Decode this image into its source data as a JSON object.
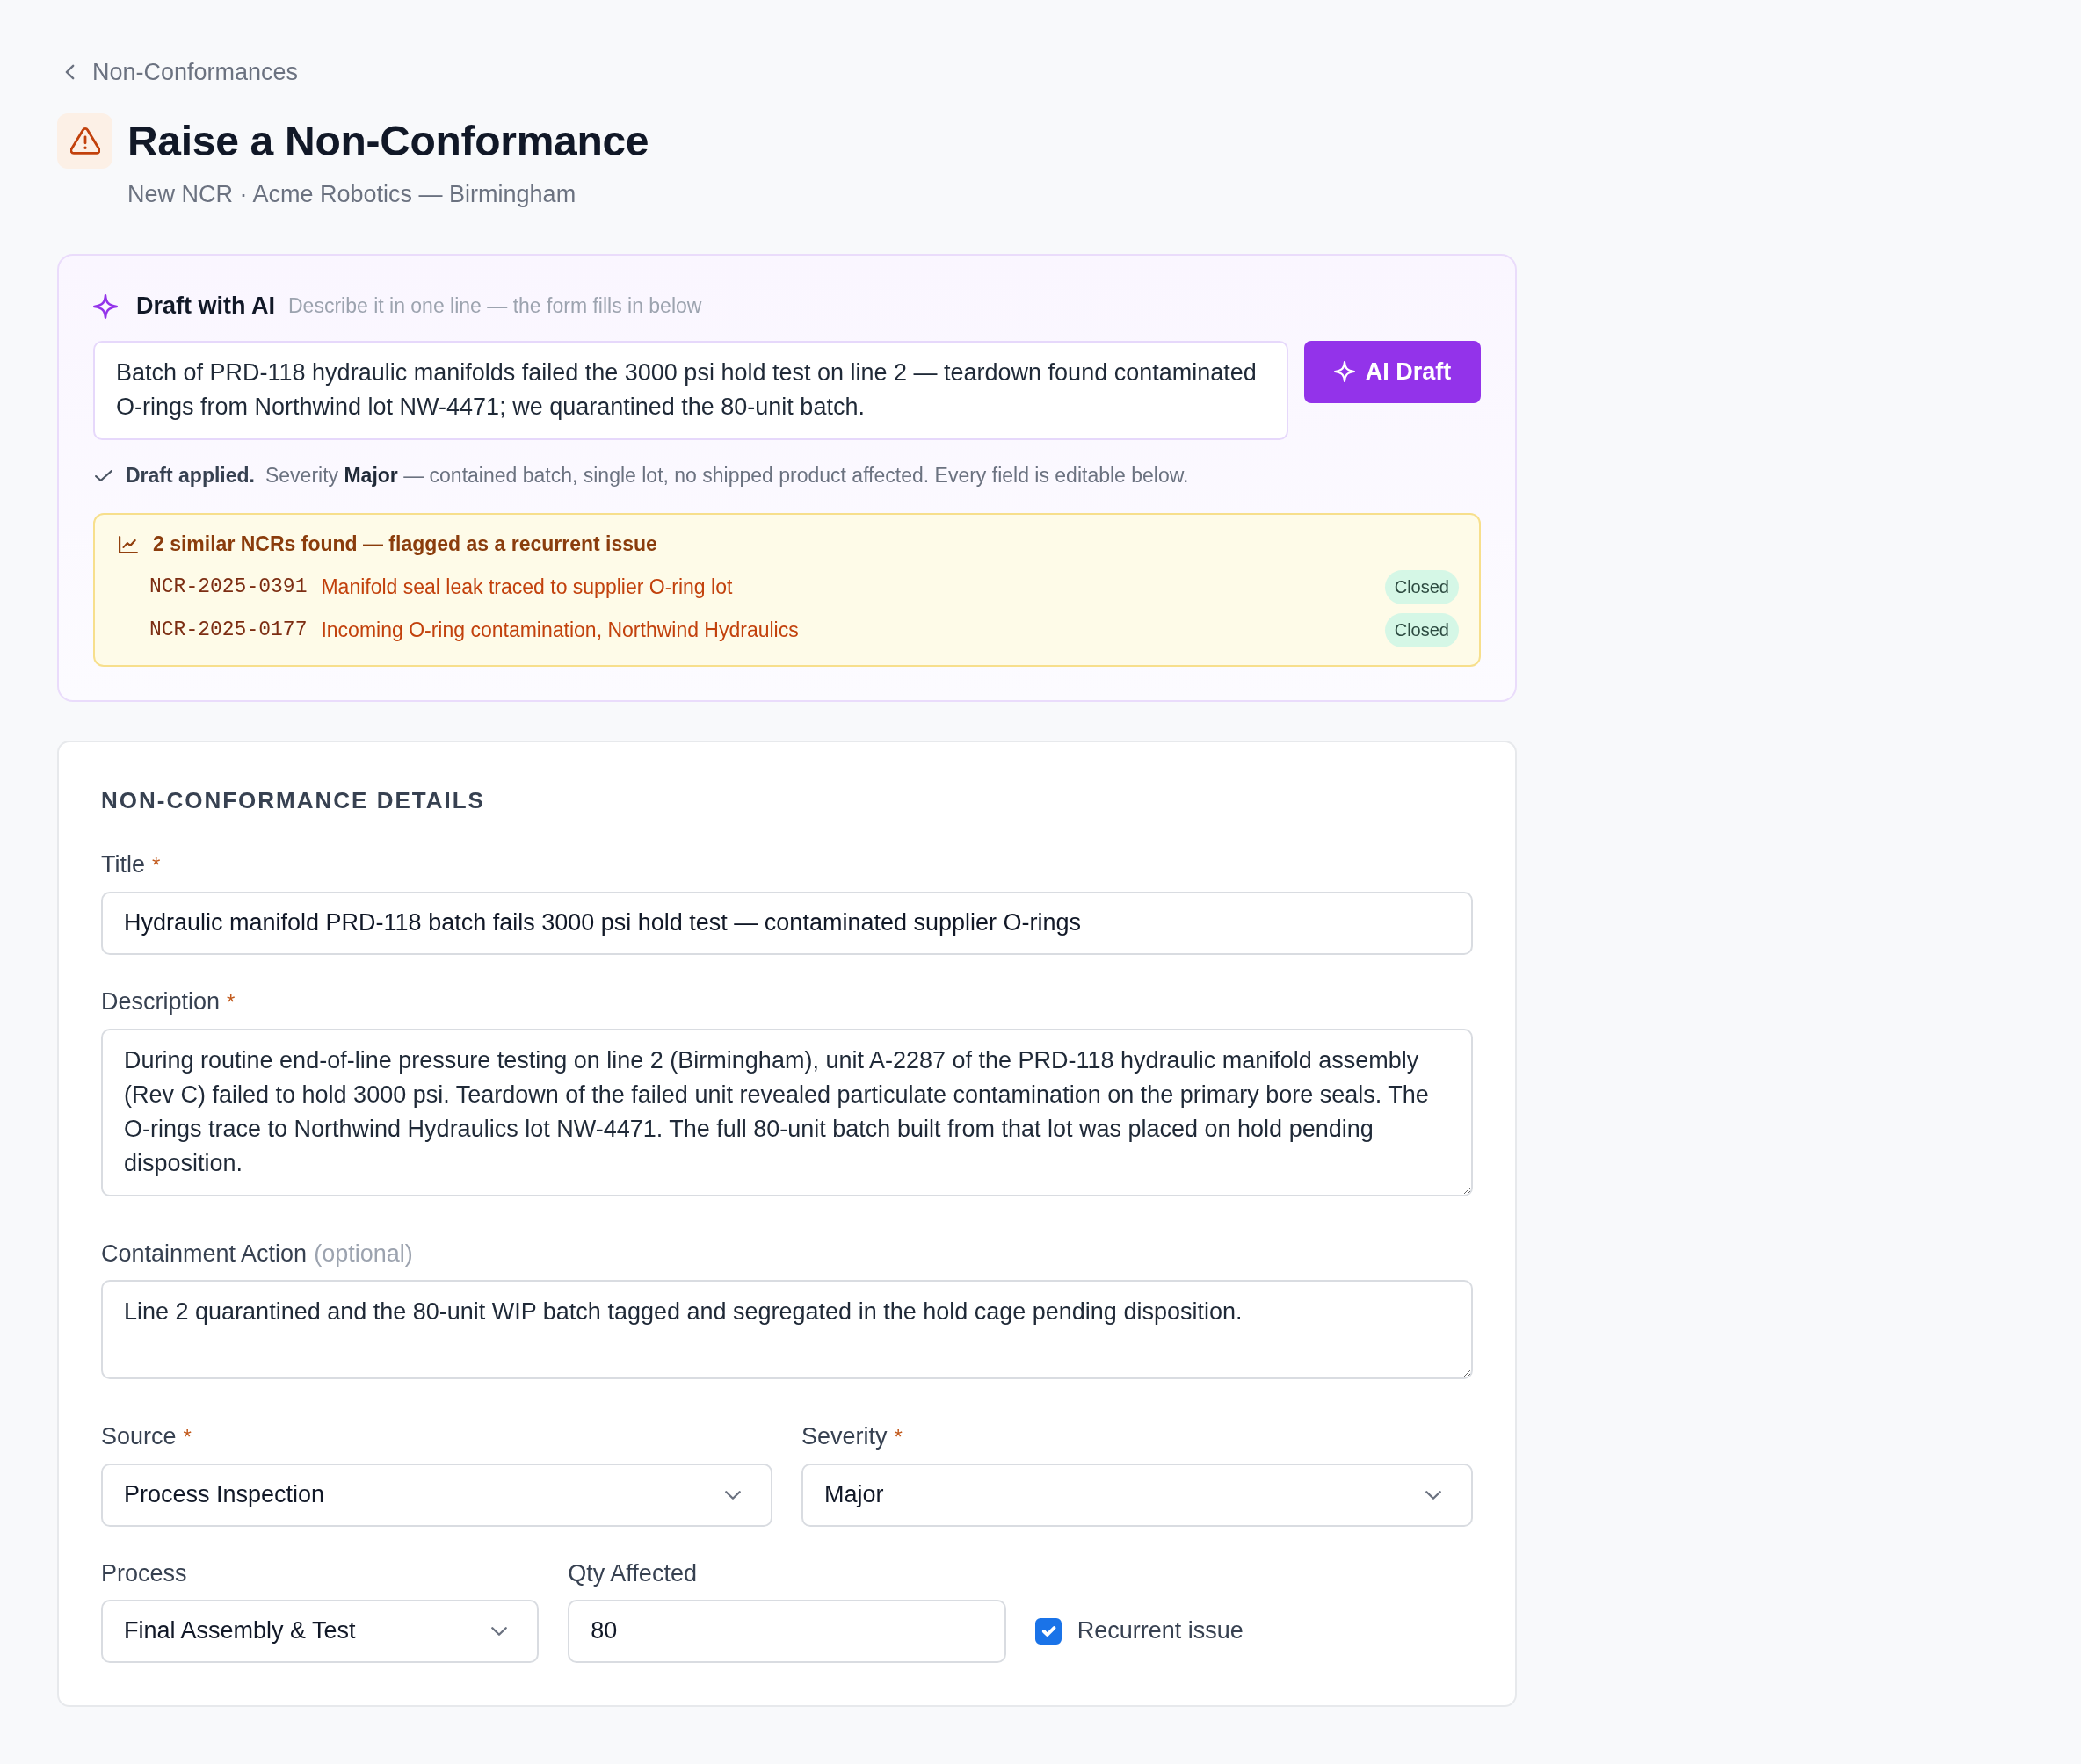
{
  "breadcrumb": {
    "label": "Non-Conformances"
  },
  "header": {
    "title": "Raise a Non-Conformance",
    "subtitle": "New NCR · Acme Robotics — Birmingham"
  },
  "ai_draft": {
    "title": "Draft with AI",
    "hint": "Describe it in one line — the form fills in below",
    "prompt": "Batch of PRD-118 hydraulic manifolds failed the 3000 psi hold test on line 2 — teardown found contaminated O-rings from Northwind lot NW-4471; we quarantined the 80-unit batch.",
    "button": "AI Draft",
    "status_label": "Draft applied.",
    "status_text": "Severity **Major** — contained batch, single lot, no shipped product affected. Every field is editable below."
  },
  "similar": {
    "heading": "2 similar NCRs found — flagged as a recurrent issue",
    "items": [
      {
        "id": "NCR-2025-0391",
        "title": "Manifold seal leak traced to supplier O-ring lot",
        "status": "Closed"
      },
      {
        "id": "NCR-2025-0177",
        "title": "Incoming O-ring contamination, Northwind Hydraulics",
        "status": "Closed"
      }
    ]
  },
  "details": {
    "heading": "NON-CONFORMANCE DETAILS",
    "rows": [
      {
        "fields": [
          {
            "kind": "text",
            "label": "Title",
            "required_mark": "*",
            "value": "Hydraulic manifold PRD-118 batch fails 3000 psi hold test — contaminated supplier O-rings"
          }
        ]
      },
      {
        "fields": [
          {
            "kind": "textarea",
            "label": "Description",
            "required_mark": "*",
            "value": "During routine end-of-line pressure testing on line 2 (Birmingham), unit A-2287 of the PRD-118 hydraulic manifold assembly (Rev C) failed to hold 3000 psi. Teardown of the failed unit revealed particulate contamination on the primary bore seals. The O-rings trace to Northwind Hydraulics lot NW-4471. The full 80-unit batch built from that lot was placed on hold pending disposition."
          }
        ]
      },
      {
        "fields": [
          {
            "kind": "textarea",
            "label": "Containment Action",
            "note": "(optional)",
            "value": "Line 2 quarantined and the 80-unit WIP batch tagged and segregated in the hold cage pending disposition."
          }
        ]
      },
      {
        "fields": [
          {
            "kind": "select",
            "label": "Source",
            "required_mark": "*",
            "value": "Process Inspection"
          },
          {
            "kind": "select",
            "label": "Severity",
            "required_mark": "*",
            "value": "Major"
          }
        ]
      },
      {
        "fields": [
          {
            "kind": "select",
            "label": "Process",
            "value": "Final Assembly & Test"
          },
          {
            "kind": "number",
            "label": "Qty Affected",
            "value": "80"
          },
          {
            "kind": "checkbox",
            "label": "Recurrent issue",
            "checked": true
          }
        ]
      }
    ]
  }
}
